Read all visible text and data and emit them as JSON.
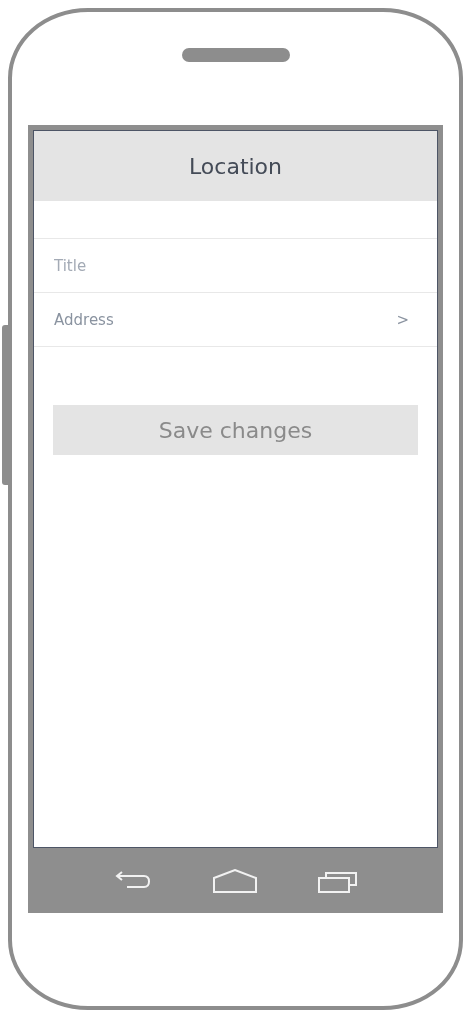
{
  "header": {
    "title": "Location"
  },
  "form": {
    "rows": [
      {
        "kind": "field",
        "placeholder": "Title"
      },
      {
        "kind": "link",
        "label": "Address",
        "chevron": ">"
      }
    ]
  },
  "save_button": {
    "label": "Save changes"
  }
}
